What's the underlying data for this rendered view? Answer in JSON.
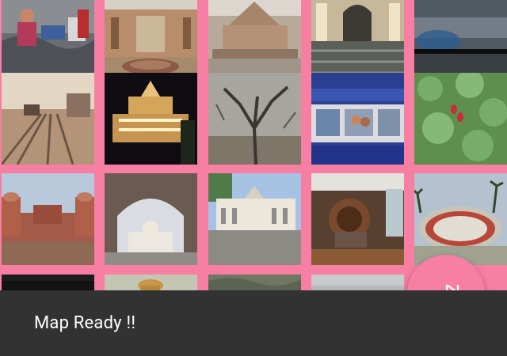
{
  "theme": {
    "background": "#f87fa4",
    "fab_color": "#f87fa4",
    "snackbar_bg": "#323232",
    "snackbar_text_color": "#ffffff"
  },
  "gallery": {
    "tiles": [
      {
        "scene": "street-market-photo"
      },
      {
        "scene": "palace-courtyard-photo"
      },
      {
        "scene": "temple-complex-photo"
      },
      {
        "scene": "arched-hall-photo"
      },
      {
        "scene": "moving-train-blur-photo"
      },
      {
        "scene": "railway-tracks-photo"
      },
      {
        "scene": "temple-night-lights-photo"
      },
      {
        "scene": "bare-tree-photo"
      },
      {
        "scene": "train-window-passengers-photo"
      },
      {
        "scene": "lotus-leaves-photo"
      },
      {
        "scene": "red-fort-photo"
      },
      {
        "scene": "arch-framed-palace-photo"
      },
      {
        "scene": "colonial-building-photo"
      },
      {
        "scene": "airport-chariot-wheel-photo"
      },
      {
        "scene": "jantar-mantar-photo"
      },
      {
        "scene": "dark-partial-photo"
      },
      {
        "scene": "dome-partial-photo"
      },
      {
        "scene": "trees-partial-photo"
      },
      {
        "scene": "sky-partial-photo"
      }
    ]
  },
  "fab": {
    "icon": "navigation-icon"
  },
  "snackbar": {
    "message": "Map Ready !!"
  }
}
